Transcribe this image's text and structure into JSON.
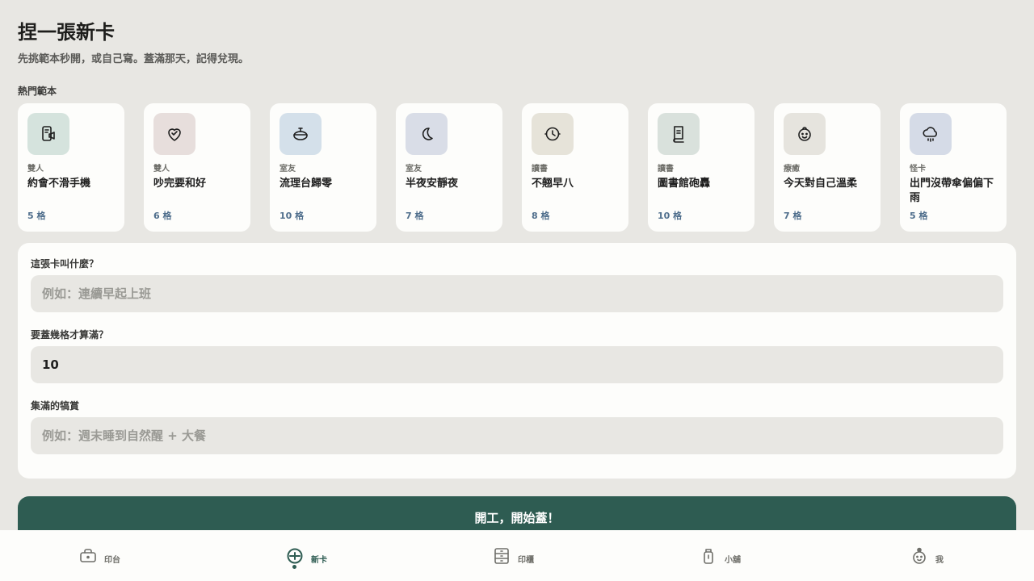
{
  "header": {
    "title": "捏一張新卡",
    "subtitle": "先挑範本秒開，或自己寫。蓋滿那天，記得兌現。"
  },
  "templates_section": {
    "label": "熱門範本",
    "items": [
      {
        "category": "雙人",
        "name": "約會不滑手機",
        "count": "5 格",
        "icon": "phone-off-icon",
        "bg": "#d5e3dd"
      },
      {
        "category": "雙人",
        "name": "吵完要和好",
        "count": "6 格",
        "icon": "heart-check-icon",
        "bg": "#e7dedc"
      },
      {
        "category": "室友",
        "name": "流理台歸零",
        "count": "10 格",
        "icon": "sink-icon",
        "bg": "#d4e0ea"
      },
      {
        "category": "室友",
        "name": "半夜安靜夜",
        "count": "7 格",
        "icon": "moon-icon",
        "bg": "#d9dde7"
      },
      {
        "category": "讀書",
        "name": "不翹早八",
        "count": "8 格",
        "icon": "clock-icon",
        "bg": "#e6e3d9"
      },
      {
        "category": "讀書",
        "name": "圖書館砲轟",
        "count": "10 格",
        "icon": "book-icon",
        "bg": "#d9e1dc"
      },
      {
        "category": "療癒",
        "name": "今天對自己溫柔",
        "count": "7 格",
        "icon": "smile-face-icon",
        "bg": "#e6e4de"
      },
      {
        "category": "怪卡",
        "name": "出門沒帶傘偏偏下雨",
        "count": "5 格",
        "icon": "rain-cloud-icon",
        "bg": "#d5dbe7"
      }
    ]
  },
  "form": {
    "name_label": "這張卡叫什麼？",
    "name_placeholder": "例如：連續早起上班",
    "slots_label": "要蓋幾格才算滿？",
    "slots_value": "10",
    "reward_label": "集滿的犒賞",
    "reward_placeholder": "例如：週末睡到自然醒 + 大餐"
  },
  "start_button": "開工，開始蓋！",
  "nav": {
    "items": [
      {
        "label": "印台",
        "icon": "stamp-pad-icon",
        "active": false
      },
      {
        "label": "新卡",
        "icon": "add-card-icon",
        "active": true
      },
      {
        "label": "印櫃",
        "icon": "cabinet-icon",
        "active": false
      },
      {
        "label": "小舖",
        "icon": "shop-jar-icon",
        "active": false
      },
      {
        "label": "我",
        "icon": "profile-icon",
        "active": false
      }
    ]
  },
  "colors": {
    "accent": "#2e5c52",
    "background": "#e8e7e3",
    "count_text": "#4f6e8c"
  }
}
